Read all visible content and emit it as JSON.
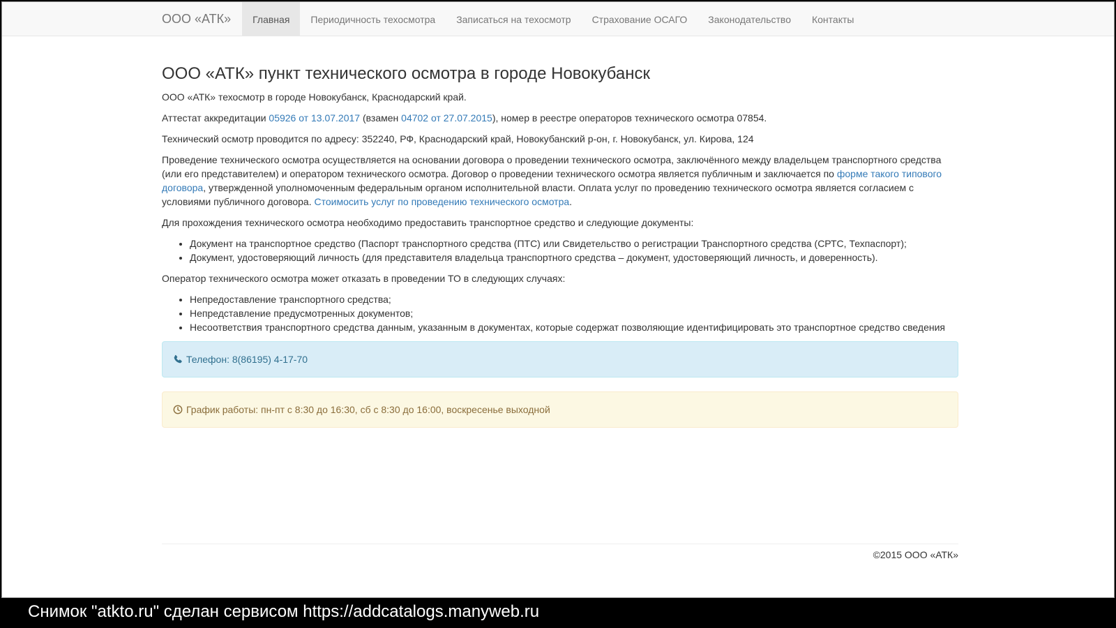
{
  "navbar": {
    "brand": "ООО «АТК»",
    "items": [
      {
        "label": "Главная"
      },
      {
        "label": "Периодичность техосмотра"
      },
      {
        "label": "Записаться на техосмотр"
      },
      {
        "label": "Страхование ОСАГО"
      },
      {
        "label": "Законодательство"
      },
      {
        "label": "Контакты"
      }
    ]
  },
  "main": {
    "title": "ООО «АТК» пункт технического осмотра в городе Новокубанск",
    "intro": "ООО «АТК» техосмотр в городе Новокубанск, Краснодарский край.",
    "accreditation": {
      "prefix": "Аттестат аккредитации ",
      "link1": "05926 от 13.07.2017",
      "middle": " (взамен ",
      "link2": "04702 от 27.07.2015",
      "suffix": "), номер в реестре операторов технического осмотра 07854."
    },
    "address": "Технический осмотр проводится по адресу: 352240, РФ, Краснодарский край, Новокубанский р-он, г. Новокубанск, ул. Кирова, 124",
    "contract": {
      "text1": "Проведение технического осмотра осуществляется на основании договора о проведении технического осмотра, заключённого между владельцем транспортного средства (или его представителем) и оператором технического осмотра. Договор о проведении технического осмотра является публичным и заключается по ",
      "link1": "форме такого типового договора",
      "text2": ", утвержденной уполномоченным федеральным органом исполнительной власти. Оплата услуг по проведению технического осмотра является согласием с условиями публичного договора. ",
      "link2": "Стоимосить услуг по проведению технического осмотра",
      "text3": "."
    },
    "documents_intro": "Для прохождения технического осмотра необходимо предоставить транспортное средство и следующие документы:",
    "documents": [
      "Документ на транспортное средство (Паспорт транспортного средства (ПТС) или Свидетельство о регистрации Транспортного средства (СРТС, Техпаспорт);",
      "Документ, удостоверяющий личность (для представителя владельца транспортного средства – документ, удостоверяющий личность, и доверенность)."
    ],
    "refusal_intro": "Оператор технического осмотра может отказать в проведении ТО в следующих случаях:",
    "refusals": [
      "Непредоставление транспортного средства;",
      "Непредставление предусмотренных документов;",
      "Несоответствия транспортного средства данным, указанным в документах, которые содержат позволяющие идентифицировать это транспортное средство сведения"
    ],
    "phone": "Телефон: 8(86195) 4-17-70",
    "schedule": "График работы: пн-пт с 8:30 до 16:30, сб с 8:30 до 16:00, воскресенье выходной"
  },
  "footer": {
    "copyright": "©2015 ООО «АТК»"
  },
  "caption": "Снимок \"atkto.ru\" сделан сервисом https://addcatalogs.manyweb.ru",
  "colors": {
    "link": "#337ab7",
    "info_bg": "#d9edf7",
    "warning_bg": "#fcf8e3"
  },
  "icons": {
    "phone": "phone-icon",
    "clock": "clock-icon"
  }
}
